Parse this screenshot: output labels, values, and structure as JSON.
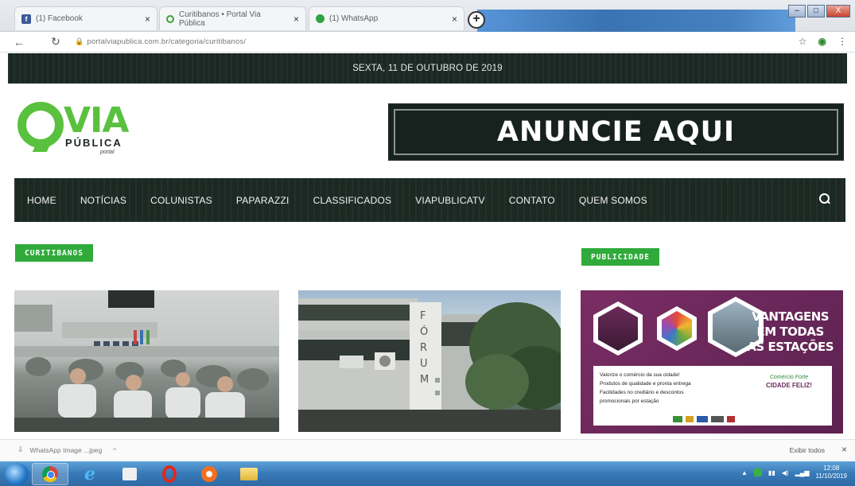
{
  "browser": {
    "tabs": [
      {
        "label": "(1) Facebook",
        "icon": "facebook-icon"
      },
      {
        "label": "Curitibanos • Portal Via Pública",
        "icon": "via-publica-favicon"
      },
      {
        "label": "(1) WhatsApp",
        "icon": "whatsapp-icon"
      }
    ],
    "new_tab_label": "+",
    "url": "portalviapublica.com.br/categoria/curitibanos/",
    "window_controls": [
      "–",
      "□",
      "X"
    ]
  },
  "site": {
    "date": "SEXTA, 11 DE OUTUBRO DE 2019",
    "logo": {
      "via": "VIA",
      "publica": "PÚBLICA",
      "portal": "portal"
    },
    "banner_text": "ANUNCIE AQUI",
    "nav": [
      "HOME",
      "NOTÍCIAS",
      "COLUNISTAS",
      "PAPARAZZI",
      "CLASSIFICADOS",
      "VIAPUBLICATV",
      "CONTATO",
      "QUEM SOMOS"
    ],
    "section_label": "CURITIBANOS",
    "sidebar_label": "PUBLICIDADE",
    "ad": {
      "headline": [
        "VANTAGENS",
        "EM TODAS",
        "AS ESTAÇÕES"
      ],
      "lines": [
        "Valorize o comércio da sua cidade!",
        "Produtos de qualidade e pronta entrega",
        "Facilidades no crediário e descontos",
        "promocionais por estação"
      ],
      "logo_small": "Comércio Forte",
      "logo_big": "CIDADE FELIZ!"
    },
    "image2_sign": "FÓRUM"
  },
  "download": {
    "filename": "WhatsApp Image ...jpeg",
    "chevron": "^",
    "show_all": "Exibir todos",
    "close": "×"
  },
  "taskbar": {
    "time": "12:08",
    "date": "11/10/2019"
  },
  "colors": {
    "brand_green": "#5ac13e",
    "badge_green": "#2faa3b",
    "dark_bar": "#1c2923",
    "ad_purple": "#6b2a5a"
  }
}
